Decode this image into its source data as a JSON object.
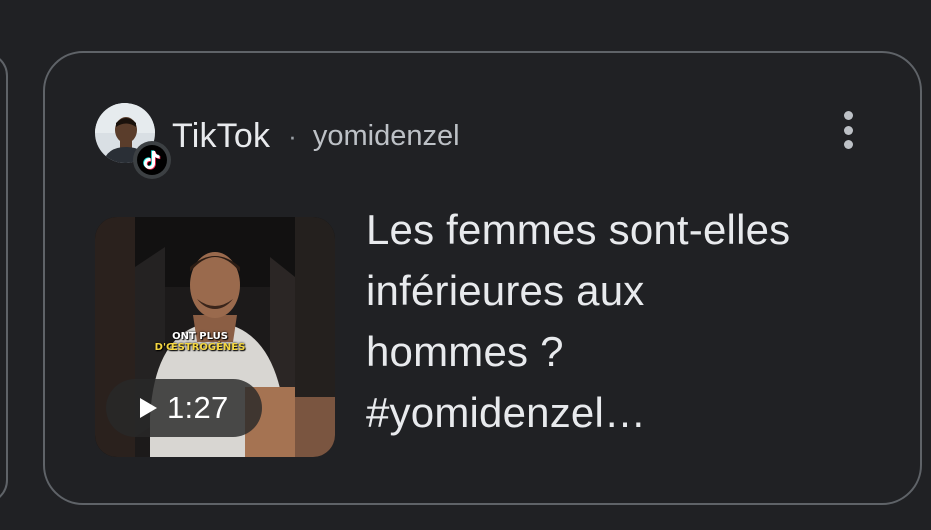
{
  "result": {
    "source": {
      "name": "TikTok",
      "separator": "·",
      "author": "yomidenzel",
      "icon": "tiktok-icon"
    },
    "more_icon": "more-vert-icon",
    "headline_lines": [
      "Les femmes sont-elles",
      "inférieures aux",
      "hommes ?",
      "#yomidenzel…"
    ],
    "thumbnail": {
      "caption_line1": "ONT PLUS",
      "caption_line2": "D'ŒSTROGÈNES",
      "duration": "1:27",
      "play_icon": "play-icon"
    }
  },
  "colors": {
    "background": "#202124",
    "card_border": "#5f6368",
    "text_primary": "#e8eaed",
    "text_secondary": "#bdc1c6"
  }
}
